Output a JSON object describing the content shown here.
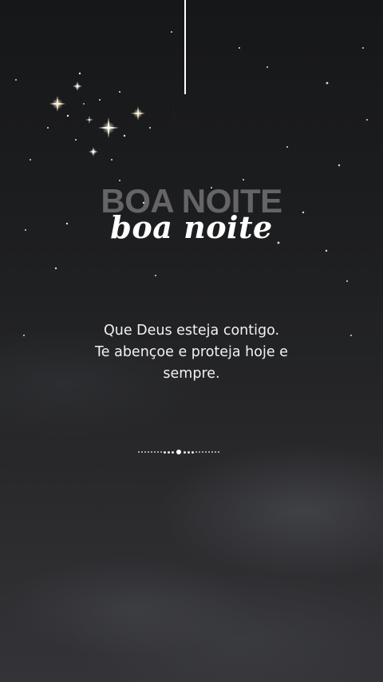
{
  "greeting": {
    "headline": "BOA NOITE",
    "script_title": "boa noite"
  },
  "message": {
    "line1": "Que Deus esteja contigo.",
    "line2": "Te abençoe e proteja hoje e",
    "line3": "sempre."
  },
  "decor": {
    "moon_icon": "crescent-moon-icon",
    "star_icon": "sparkle-star-icon"
  },
  "pager": {
    "total": 23,
    "active_index": 11
  },
  "colors": {
    "background": "#1a1b1d",
    "text": "#ffffff",
    "headline_faded": "#bebebe"
  }
}
